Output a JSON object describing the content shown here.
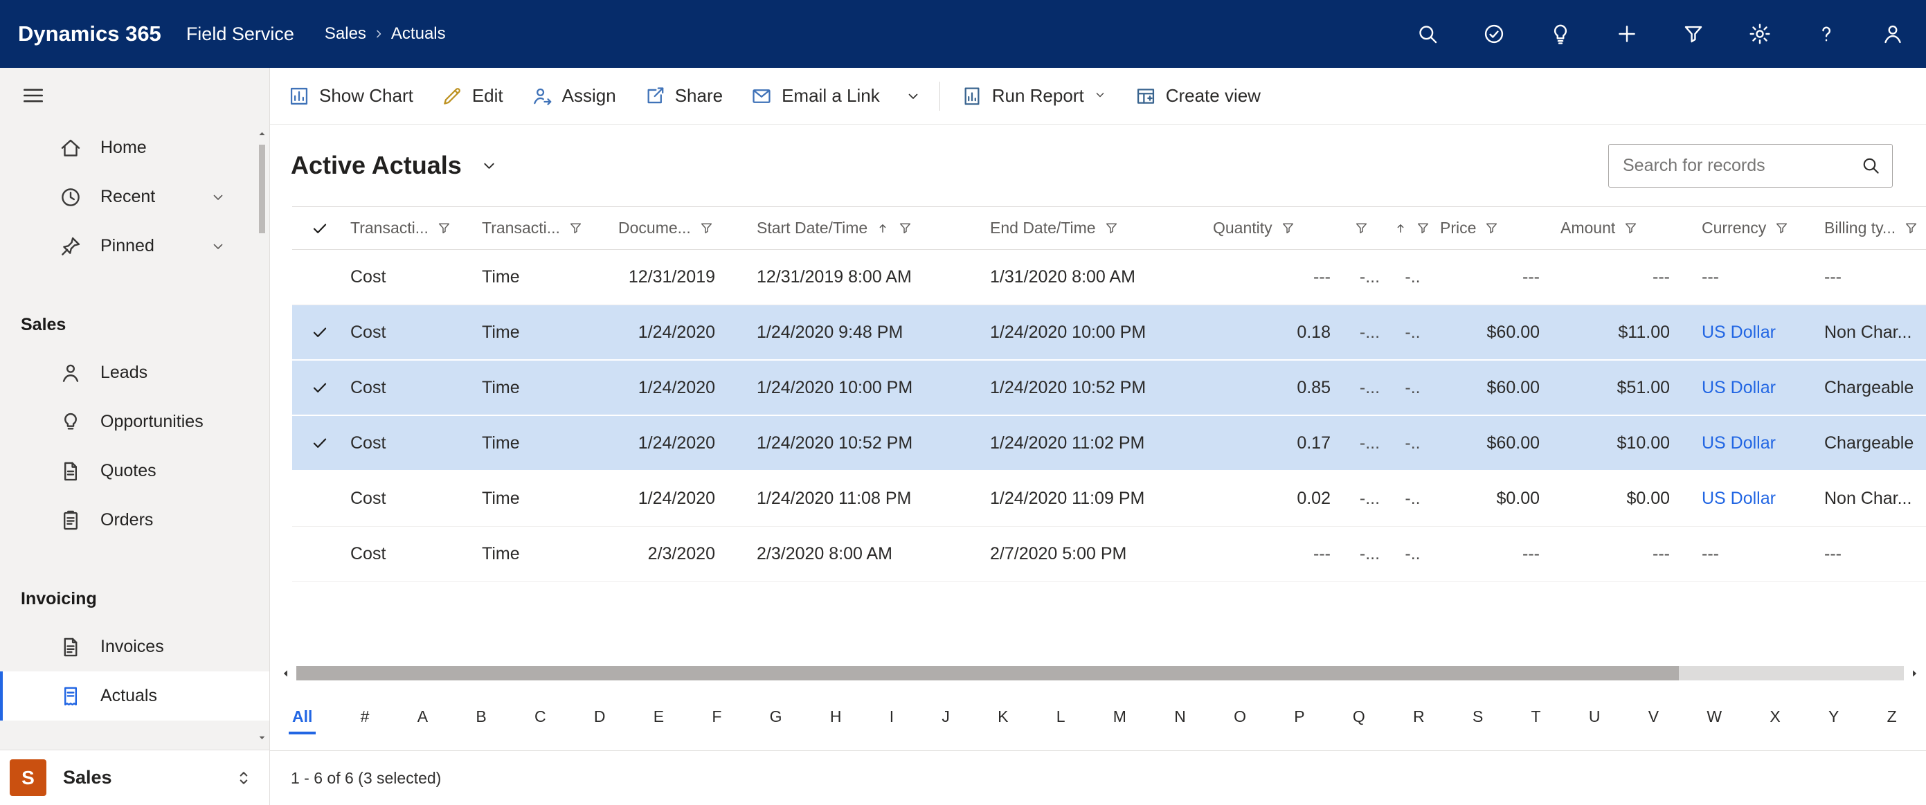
{
  "topnav": {
    "brand": "Dynamics 365",
    "app": "Field Service",
    "breadcrumb": [
      "Sales",
      "Actuals"
    ],
    "icons": [
      "search",
      "check-circle",
      "lightbulb",
      "plus",
      "filter",
      "gear",
      "help",
      "person"
    ]
  },
  "sidebar": {
    "items_top": [
      {
        "label": "Home",
        "icon": "home"
      },
      {
        "label": "Recent",
        "icon": "clock",
        "chevron": true
      },
      {
        "label": "Pinned",
        "icon": "pin",
        "chevron": true
      }
    ],
    "groups": [
      {
        "title": "Sales",
        "items": [
          {
            "label": "Leads",
            "icon": "leads"
          },
          {
            "label": "Opportunities",
            "icon": "opportunities"
          },
          {
            "label": "Quotes",
            "icon": "quotes"
          },
          {
            "label": "Orders",
            "icon": "orders"
          }
        ]
      },
      {
        "title": "Invoicing",
        "items": [
          {
            "label": "Invoices",
            "icon": "invoices"
          },
          {
            "label": "Actuals",
            "icon": "actuals",
            "selected": true
          }
        ]
      }
    ],
    "area_switcher": {
      "initial": "S",
      "label": "Sales"
    }
  },
  "command_bar": {
    "items": [
      {
        "label": "Show Chart",
        "icon": "chart"
      },
      {
        "label": "Edit",
        "icon": "pencil"
      },
      {
        "label": "Assign",
        "icon": "assign"
      },
      {
        "label": "Share",
        "icon": "share"
      },
      {
        "label": "Email a Link",
        "icon": "email"
      },
      {
        "type": "overflow",
        "icon": "chevron-down"
      },
      {
        "type": "divider"
      },
      {
        "label": "Run Report",
        "icon": "report",
        "chevron": true
      },
      {
        "label": "Create view",
        "icon": "create-view"
      }
    ]
  },
  "view": {
    "title": "Active Actuals",
    "search_placeholder": "Search for records"
  },
  "grid": {
    "columns": [
      {
        "key": "select",
        "type": "check",
        "label": ""
      },
      {
        "key": "transaction_type",
        "label": "Transacti...",
        "filter": true
      },
      {
        "key": "transaction_class",
        "label": "Transacti...",
        "filter": true
      },
      {
        "key": "document_date",
        "label": "Docume...",
        "filter": true,
        "align": "right"
      },
      {
        "key": "start",
        "label": "Start Date/Time",
        "filter": true,
        "sort": "asc"
      },
      {
        "key": "end",
        "label": "End Date/Time",
        "filter": true
      },
      {
        "key": "quantity",
        "label": "Quantity",
        "filter": true,
        "align": "right"
      },
      {
        "key": "narrow1",
        "label": "",
        "filter": true,
        "align": "center"
      },
      {
        "key": "narrow2",
        "label": "",
        "filter": true,
        "sort": "asc",
        "align": "center"
      },
      {
        "key": "price",
        "label": "Price",
        "filter": true,
        "align": "right"
      },
      {
        "key": "amount",
        "label": "Amount",
        "filter": true,
        "align": "right"
      },
      {
        "key": "currency",
        "label": "Currency",
        "filter": true,
        "link": true
      },
      {
        "key": "billing_type",
        "label": "Billing ty...",
        "filter": true
      }
    ],
    "rows": [
      {
        "selected": false,
        "cells": [
          "Cost",
          "Time",
          "12/31/2019",
          "12/31/2019 8:00 AM",
          "1/31/2020 8:00 AM",
          "---",
          "-...",
          "-..",
          "---",
          "---",
          "---",
          "---"
        ]
      },
      {
        "selected": true,
        "cells": [
          "Cost",
          "Time",
          "1/24/2020",
          "1/24/2020 9:48 PM",
          "1/24/2020 10:00 PM",
          "0.18",
          "-...",
          "-..",
          "$60.00",
          "$11.00",
          "US Dollar",
          "Non Char..."
        ]
      },
      {
        "selected": true,
        "cells": [
          "Cost",
          "Time",
          "1/24/2020",
          "1/24/2020 10:00 PM",
          "1/24/2020 10:52 PM",
          "0.85",
          "-...",
          "-..",
          "$60.00",
          "$51.00",
          "US Dollar",
          "Chargeable"
        ]
      },
      {
        "selected": true,
        "cells": [
          "Cost",
          "Time",
          "1/24/2020",
          "1/24/2020 10:52 PM",
          "1/24/2020 11:02 PM",
          "0.17",
          "-...",
          "-..",
          "$60.00",
          "$10.00",
          "US Dollar",
          "Chargeable"
        ]
      },
      {
        "selected": false,
        "cells": [
          "Cost",
          "Time",
          "1/24/2020",
          "1/24/2020 11:08 PM",
          "1/24/2020 11:09 PM",
          "0.02",
          "-...",
          "-..",
          "$0.00",
          "$0.00",
          "US Dollar",
          "Non Char..."
        ]
      },
      {
        "selected": false,
        "cells": [
          "Cost",
          "Time",
          "2/3/2020",
          "2/3/2020 8:00 AM",
          "2/7/2020 5:00 PM",
          "---",
          "-...",
          "-..",
          "---",
          "---",
          "---",
          "---"
        ]
      }
    ]
  },
  "jumpbar": {
    "items": [
      "All",
      "#",
      "A",
      "B",
      "C",
      "D",
      "E",
      "F",
      "G",
      "H",
      "I",
      "J",
      "K",
      "L",
      "M",
      "N",
      "O",
      "P",
      "Q",
      "R",
      "S",
      "T",
      "U",
      "V",
      "W",
      "X",
      "Y",
      "Z"
    ],
    "selected": "All"
  },
  "statusbar": {
    "text": "1 - 6 of 6 (3 selected)"
  },
  "colors": {
    "topnav_bg": "#062c6a",
    "accent": "#2266e3",
    "selected_row_bg": "#cfe0f5",
    "area_badge_bg": "#ca5010"
  }
}
